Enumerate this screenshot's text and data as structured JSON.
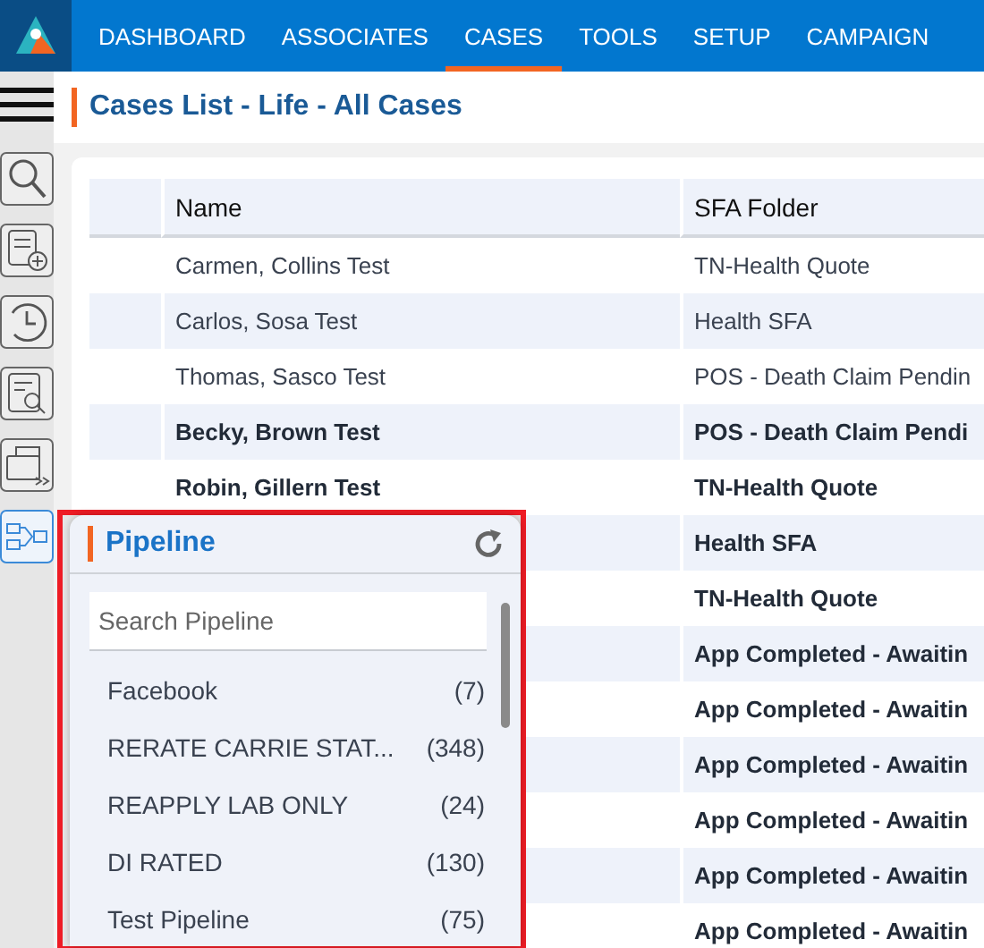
{
  "nav": {
    "items": [
      {
        "label": "DASHBOARD",
        "selected": false
      },
      {
        "label": "ASSOCIATES",
        "selected": false
      },
      {
        "label": "CASES",
        "selected": true
      },
      {
        "label": "TOOLS",
        "selected": false
      },
      {
        "label": "SETUP",
        "selected": false
      },
      {
        "label": "CAMPAIGN",
        "selected": false
      }
    ]
  },
  "page_title": "Cases List - Life - All Cases",
  "table": {
    "columns": [
      "Name",
      "SFA Folder"
    ],
    "rows": [
      {
        "name": "Carmen, Collins Test",
        "folder": "TN-Health Quote",
        "unread": false
      },
      {
        "name": "Carlos, Sosa Test",
        "folder": "Health SFA",
        "unread": false
      },
      {
        "name": "Thomas, Sasco Test",
        "folder": "POS - Death Claim Pendin",
        "unread": false
      },
      {
        "name": "Becky, Brown Test",
        "folder": "POS - Death Claim Pendi",
        "unread": true
      },
      {
        "name": "Robin, Gillern Test",
        "folder": "TN-Health Quote",
        "unread": true
      },
      {
        "folder": "Health SFA",
        "unread": true
      },
      {
        "folder": "TN-Health Quote",
        "unread": true
      },
      {
        "folder": "App Completed - Awaitin",
        "unread": true
      },
      {
        "folder": "App Completed - Awaitin",
        "unread": true
      },
      {
        "folder": "App Completed - Awaitin",
        "unread": true
      },
      {
        "folder": "App Completed - Awaitin",
        "unread": true
      },
      {
        "folder": "App Completed - Awaitin",
        "unread": true
      },
      {
        "folder": "App Completed - Awaitin",
        "unread": true
      }
    ]
  },
  "pipeline": {
    "title": "Pipeline",
    "search": {
      "placeholder": "Search Pipeline"
    },
    "items": [
      {
        "label": "Facebook",
        "count": "(7)"
      },
      {
        "label": "RERATE CARRIE STAT...",
        "count": "(348)"
      },
      {
        "label": "REAPPLY LAB ONLY",
        "count": "(24)"
      },
      {
        "label": "DI RATED",
        "count": "(130)"
      },
      {
        "label": "Test Pipeline",
        "count": "(75)"
      }
    ]
  }
}
